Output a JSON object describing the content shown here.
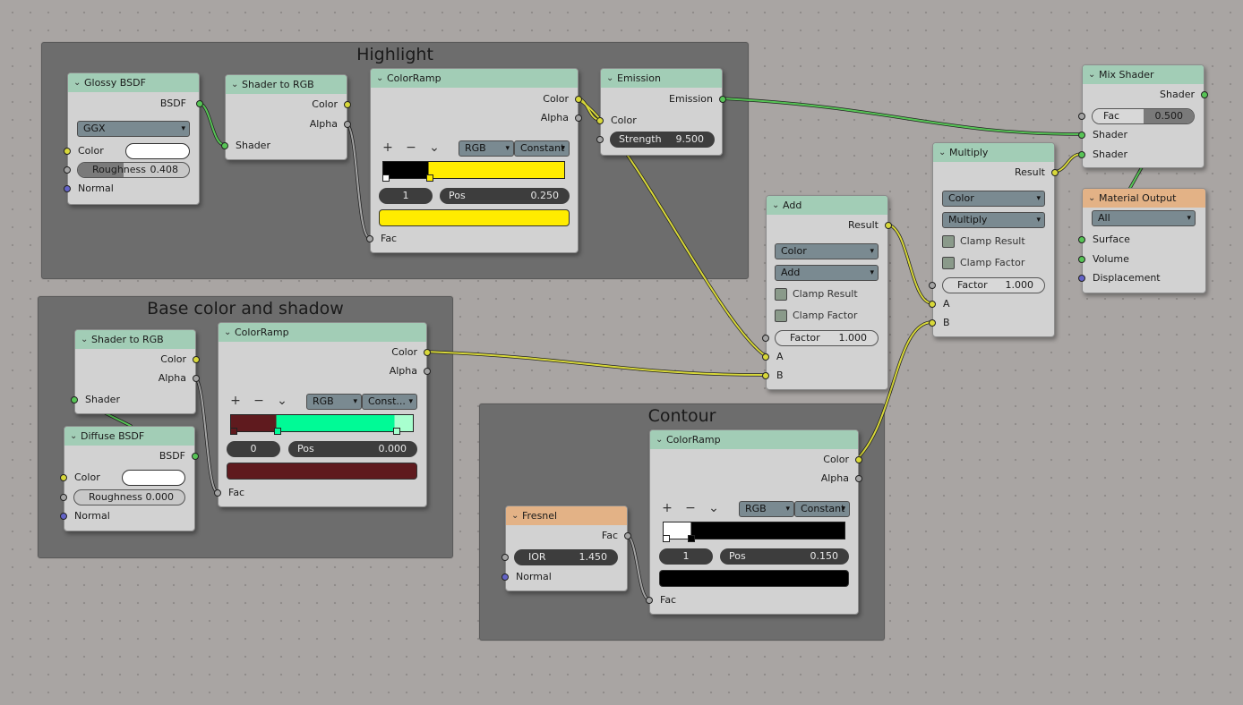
{
  "frames": {
    "highlight": "Highlight",
    "base": "Base color and shadow",
    "contour": "Contour"
  },
  "glossy": {
    "title": "Glossy BSDF",
    "out_bsdf": "BSDF",
    "distribution": "GGX",
    "color_label": "Color",
    "color_value": "#ffffff",
    "roughness_label": "Roughness",
    "roughness_value": "0.408",
    "normal_label": "Normal"
  },
  "shader_rgb_1": {
    "title": "Shader to RGB",
    "out_color": "Color",
    "out_alpha": "Alpha",
    "in_shader": "Shader"
  },
  "ramp_highlight": {
    "title": "ColorRamp",
    "out_color": "Color",
    "out_alpha": "Alpha",
    "mode": "RGB",
    "interp": "Constant",
    "stop_index": "1",
    "pos_label": "Pos",
    "pos_value": "0.250",
    "selected_color": "#ffec00",
    "in_fac": "Fac"
  },
  "emission": {
    "title": "Emission",
    "out_emission": "Emission",
    "in_color": "Color",
    "strength_label": "Strength",
    "strength_value": "9.500"
  },
  "mix_shader": {
    "title": "Mix Shader",
    "out_shader": "Shader",
    "fac_label": "Fac",
    "fac_value": "0.500",
    "in_shader_1": "Shader",
    "in_shader_2": "Shader"
  },
  "material_output": {
    "title": "Material Output",
    "target": "All",
    "surface": "Surface",
    "volume": "Volume",
    "displacement": "Displacement"
  },
  "multiply": {
    "title": "Multiply",
    "out_result": "Result",
    "data_type": "Color",
    "blend": "Multiply",
    "clamp_result": "Clamp Result",
    "clamp_factor": "Clamp Factor",
    "factor_label": "Factor",
    "factor_value": "1.000",
    "in_a": "A",
    "in_b": "B"
  },
  "add": {
    "title": "Add",
    "out_result": "Result",
    "data_type": "Color",
    "blend": "Add",
    "clamp_result": "Clamp Result",
    "clamp_factor": "Clamp Factor",
    "factor_label": "Factor",
    "factor_value": "1.000",
    "in_a": "A",
    "in_b": "B"
  },
  "shader_rgb_2": {
    "title": "Shader to RGB",
    "out_color": "Color",
    "out_alpha": "Alpha",
    "in_shader": "Shader"
  },
  "ramp_base": {
    "title": "ColorRamp",
    "out_color": "Color",
    "out_alpha": "Alpha",
    "mode": "RGB",
    "interp": "Const...",
    "stop_index": "0",
    "pos_label": "Pos",
    "pos_value": "0.000",
    "selected_color": "#5f1a1e",
    "in_fac": "Fac"
  },
  "diffuse": {
    "title": "Diffuse BSDF",
    "out_bsdf": "BSDF",
    "color_label": "Color",
    "color_value": "#ffffff",
    "roughness_label": "Roughness",
    "roughness_value": "0.000",
    "normal_label": "Normal"
  },
  "fresnel": {
    "title": "Fresnel",
    "out_fac": "Fac",
    "ior_label": "IOR",
    "ior_value": "1.450",
    "normal_label": "Normal"
  },
  "ramp_contour": {
    "title": "ColorRamp",
    "out_color": "Color",
    "out_alpha": "Alpha",
    "mode": "RGB",
    "interp": "Constant",
    "stop_index": "1",
    "pos_label": "Pos",
    "pos_value": "0.150",
    "selected_color": "#000000",
    "in_fac": "Fac"
  },
  "tools": {
    "add": "+",
    "remove": "−",
    "more": "⌄"
  },
  "colors": {
    "header_shader": "#a2cdb6",
    "header_input": "#e3b286",
    "frame": "#6d6d6d",
    "wire_yellow": "#d8d83a",
    "wire_green": "#57c456"
  }
}
